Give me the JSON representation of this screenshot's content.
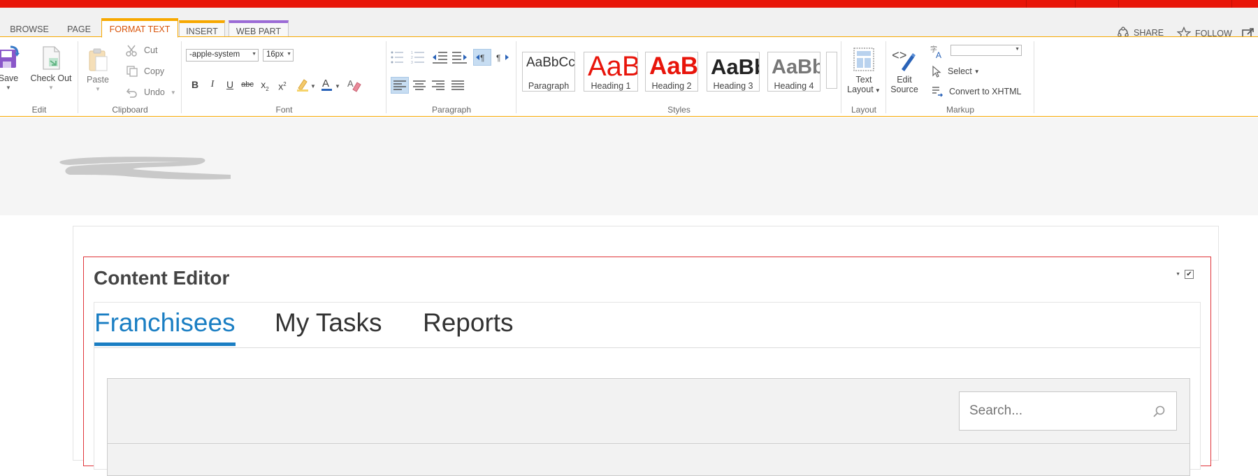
{
  "ribbon_tabs": {
    "browse": "BROWSE",
    "page": "PAGE",
    "format_text": "FORMAT TEXT",
    "insert": "INSERT",
    "web_part": "WEB PART"
  },
  "top_actions": {
    "share": "SHARE",
    "follow": "FOLLOW"
  },
  "edit_group": {
    "save": "Save",
    "check_out": "Check Out",
    "label": "Edit"
  },
  "clipboard_group": {
    "paste": "Paste",
    "cut": "Cut",
    "copy": "Copy",
    "undo": "Undo",
    "label": "Clipboard"
  },
  "font_group": {
    "font_family": "-apple-system",
    "font_size": "16px",
    "label": "Font"
  },
  "paragraph_group": {
    "label": "Paragraph"
  },
  "styles_group": {
    "label": "Styles",
    "items": [
      {
        "sample": "AaBbCcDc",
        "name": "Paragraph",
        "color": "#333333"
      },
      {
        "sample": "AaBb",
        "name": "Heading 1",
        "color": "#e8150b"
      },
      {
        "sample": "AaBb",
        "name": "Heading 2",
        "color": "#e8150b"
      },
      {
        "sample": "AaBb",
        "name": "Heading 3",
        "color": "#222222"
      },
      {
        "sample": "AaBb",
        "name": "Heading 4",
        "color": "#777777"
      }
    ]
  },
  "layout_group": {
    "text_layout_line1": "Text",
    "text_layout_line2": "Layout",
    "label": "Layout"
  },
  "markup_group": {
    "edit_source_line1": "Edit",
    "edit_source_line2": "Source",
    "select": "Select",
    "convert": "Convert to XHTML",
    "language_value": "",
    "label": "Markup"
  },
  "webpart": {
    "title": "Content Editor",
    "tabs": [
      "Franchisees",
      "My Tasks",
      "Reports"
    ],
    "search_placeholder": "Search..."
  },
  "colors": {
    "suite_bar": "#e81609",
    "accent_orange": "#f7a800",
    "active_tab_text": "#d9540a",
    "link_blue": "#1a7ec3",
    "webpart_border": "#e0353b"
  }
}
